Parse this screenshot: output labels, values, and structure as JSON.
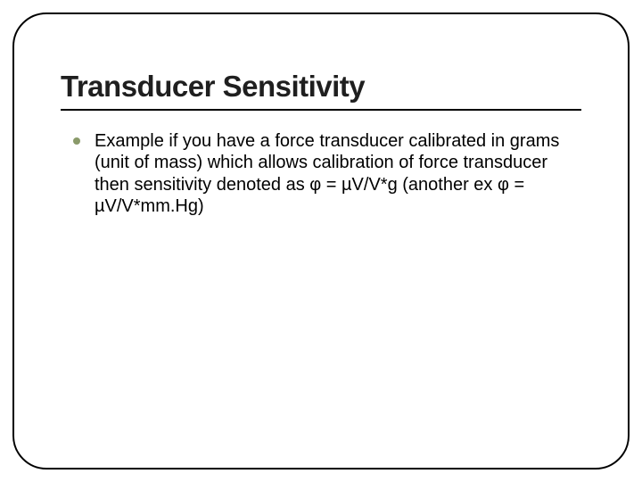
{
  "slide": {
    "title": "Transducer Sensitivity",
    "bullets": [
      {
        "text": "Example if you have a force transducer calibrated in grams (unit of mass) which allows calibration of force transducer then sensitivity denoted as φ = µV/V*g (another ex φ = µV/V*mm.Hg)"
      }
    ]
  }
}
